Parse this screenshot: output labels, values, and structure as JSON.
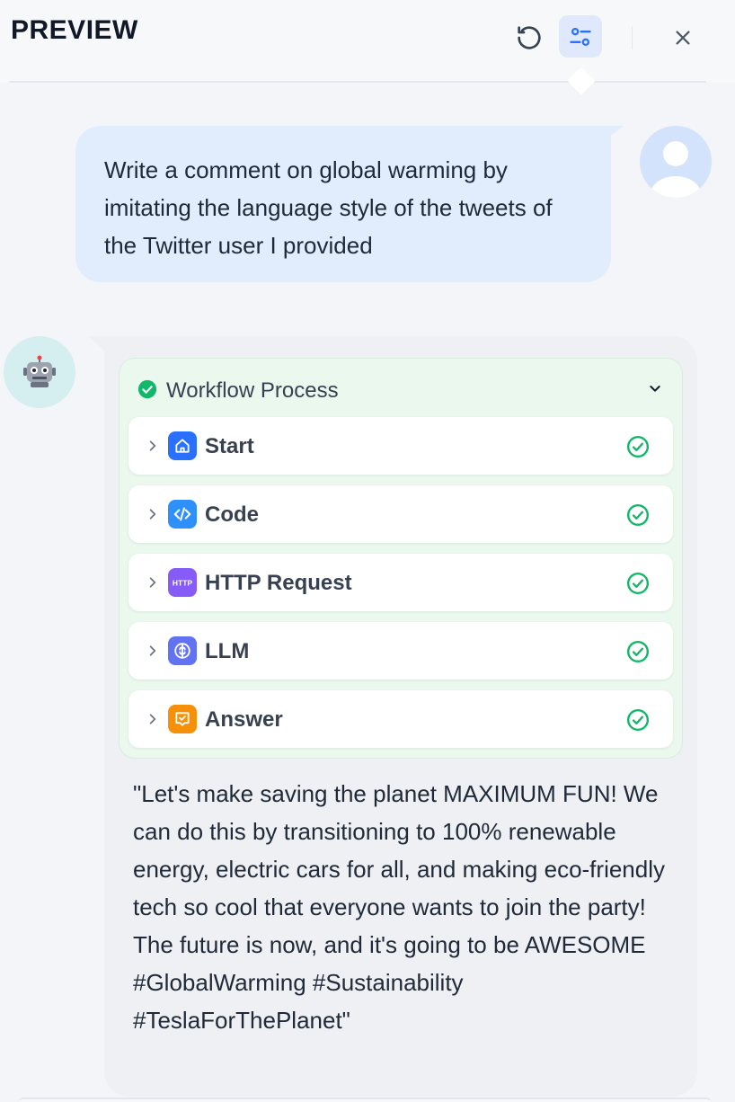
{
  "header": {
    "title": "PREVIEW",
    "refresh_icon": "refresh-icon",
    "settings_icon": "settings-sliders-icon",
    "close_icon": "close-icon"
  },
  "conversation": {
    "user_message": "Write a comment on global warming by imitating the language style of the tweets of the Twitter user I provided",
    "user_avatar_icon": "user-avatar-icon",
    "bot_avatar_icon": "robot-icon",
    "workflow": {
      "title": "Workflow Process",
      "status": "succeeded",
      "nodes": [
        {
          "label": "Start",
          "icon": "home-icon",
          "color": "#2970ff",
          "status": "succeeded"
        },
        {
          "label": "Code",
          "icon": "code-icon",
          "color": "#2e90fa",
          "status": "succeeded"
        },
        {
          "label": "HTTP Request",
          "icon": "http-icon",
          "color": "#875bf7",
          "status": "succeeded"
        },
        {
          "label": "LLM",
          "icon": "brain-icon",
          "color": "#6172f3",
          "status": "succeeded"
        },
        {
          "label": "Answer",
          "icon": "answer-icon",
          "color": "#f79009",
          "status": "succeeded"
        }
      ]
    },
    "answer": "\"Let's make saving the planet MAXIMUM FUN! We can do this by transitioning to 100% renewable energy, electric cars for all, and making eco-friendly tech so cool that everyone wants to join the party! The future is now, and it's going to be AWESOME #GlobalWarming #Sustainability #TeslaForThePlanet\""
  },
  "colors": {
    "accent": "#2970ff",
    "success": "#12b76a",
    "user_bubble": "#e1edfc",
    "bot_bubble": "#eef0f4",
    "workflow_bg": "#eaf8ee"
  }
}
